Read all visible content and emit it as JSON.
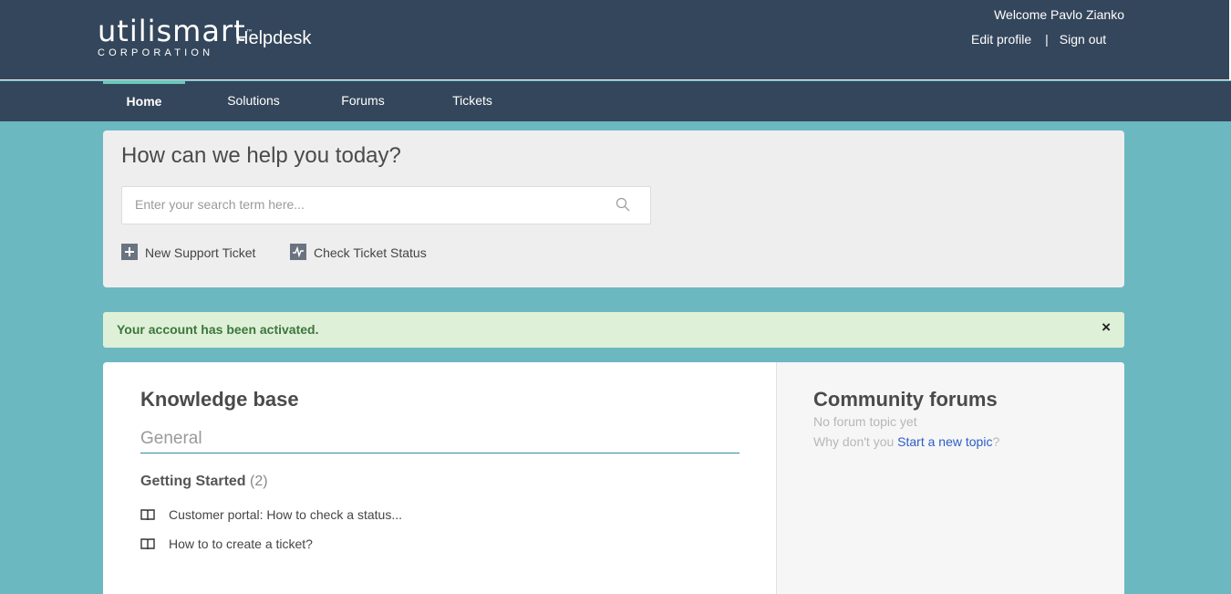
{
  "header": {
    "logo_main": "utilismart",
    "logo_tm": "™",
    "logo_sub": "CORPORATION",
    "title": "Helpdesk",
    "welcome": "Welcome Pavlo Zianko",
    "edit_profile": "Edit profile",
    "separator": "|",
    "sign_out": "Sign out"
  },
  "nav": {
    "items": [
      {
        "label": "Home",
        "active": true
      },
      {
        "label": "Solutions",
        "active": false
      },
      {
        "label": "Forums",
        "active": false
      },
      {
        "label": "Tickets",
        "active": false
      }
    ]
  },
  "search": {
    "heading": "How can we help you today?",
    "placeholder": "Enter your search term here...",
    "icon": "search-icon"
  },
  "actions": {
    "new_ticket": "New Support Ticket",
    "check_status": "Check Ticket Status"
  },
  "alert": {
    "message": "Your account has been activated.",
    "close": "×"
  },
  "knowledge_base": {
    "title": "Knowledge base",
    "category": "General",
    "folder": {
      "name": "Getting Started",
      "count": "(2)"
    },
    "articles": [
      "Customer portal: How to check a status...",
      "How to to create a ticket?"
    ]
  },
  "forums": {
    "title": "Community forums",
    "empty": "No forum topic yet",
    "prompt_prefix": "Why don't you",
    "prompt_link": "Start a new topic",
    "prompt_suffix": "?"
  },
  "colors": {
    "header_bg": "#34465b",
    "page_bg": "#6cb8c0",
    "accent": "#6cc9b8",
    "alert_bg": "#dff0d8",
    "alert_text": "#3c763d",
    "link": "#2b5ec7"
  }
}
